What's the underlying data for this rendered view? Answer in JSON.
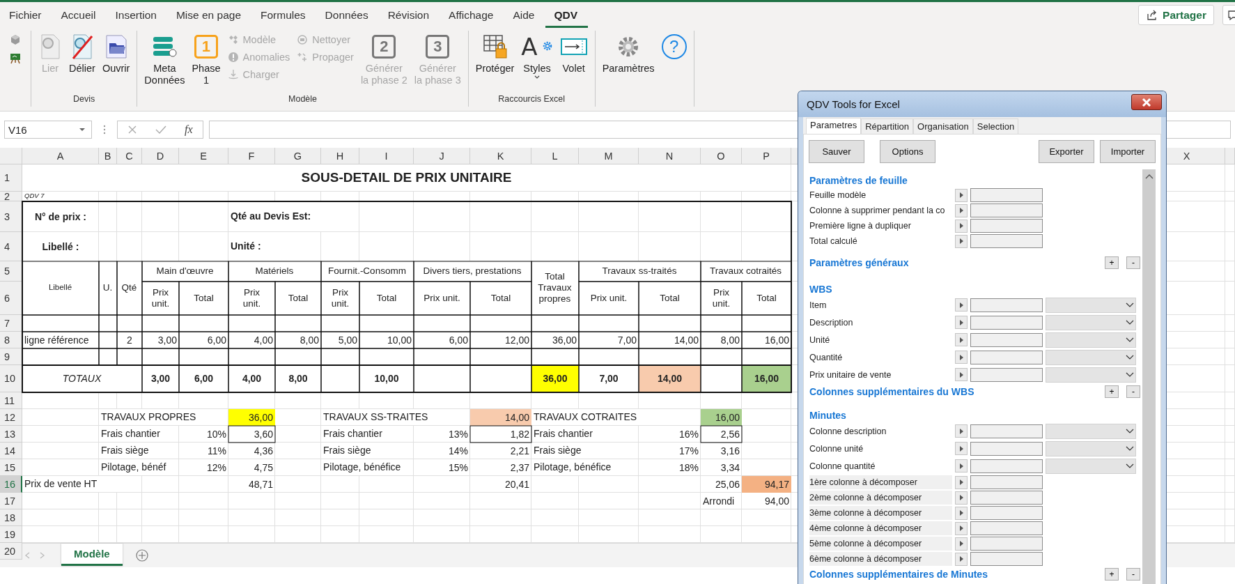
{
  "ribbon": {
    "tabs": [
      {
        "label": "Fichier",
        "selected": false
      },
      {
        "label": "Accueil",
        "selected": false
      },
      {
        "label": "Insertion",
        "selected": false
      },
      {
        "label": "Mise en page",
        "selected": false
      },
      {
        "label": "Formules",
        "selected": false
      },
      {
        "label": "Données",
        "selected": false
      },
      {
        "label": "Révision",
        "selected": false
      },
      {
        "label": "Affichage",
        "selected": false
      },
      {
        "label": "Aide",
        "selected": false
      },
      {
        "label": "QDV",
        "selected": true
      }
    ],
    "share_button": "Partager",
    "groups": [
      {
        "label": "Devis",
        "items": [
          {
            "kind": "large",
            "label": "Lier",
            "disabled": true
          },
          {
            "kind": "large",
            "label": "Délier",
            "disabled": false
          },
          {
            "kind": "large",
            "label": "Ouvrir",
            "disabled": false
          }
        ]
      },
      {
        "label": "Modèle",
        "items": [
          {
            "kind": "large",
            "label": "Meta\nDonnées",
            "disabled": false
          },
          {
            "kind": "large",
            "label": "Phase\n1",
            "badge": "1",
            "disabled": false
          },
          {
            "kind": "stack",
            "items": [
              {
                "label": "Modèle",
                "disabled": true
              },
              {
                "label": "Anomalies",
                "disabled": true
              },
              {
                "label": "Charger",
                "disabled": true
              }
            ]
          },
          {
            "kind": "stack",
            "items": [
              {
                "label": "Nettoyer",
                "disabled": true
              },
              {
                "label": "Propager",
                "disabled": true
              }
            ]
          },
          {
            "kind": "large",
            "label": "Générer\nla phase 2",
            "badge": "2",
            "disabled": true
          },
          {
            "kind": "large",
            "label": "Générer\nla phase 3",
            "badge": "3",
            "disabled": true
          }
        ]
      },
      {
        "label": "Raccourcis Excel",
        "items": [
          {
            "kind": "large",
            "label": "Protéger",
            "disabled": false
          },
          {
            "kind": "large",
            "label": "Styles",
            "badge": "A",
            "has_menu": true,
            "disabled": false
          },
          {
            "kind": "large",
            "label": "Volet",
            "disabled": false
          }
        ]
      },
      {
        "items": [
          {
            "kind": "large",
            "label": "Paramètres",
            "disabled": false
          },
          {
            "kind": "help",
            "badge": "?"
          }
        ]
      }
    ]
  },
  "formula_bar": {
    "name_box": "V16",
    "function_label": "fx"
  },
  "sheet": {
    "columns": [
      "A",
      "B",
      "C",
      "D",
      "E",
      "F",
      "G",
      "H",
      "I",
      "J",
      "K",
      "L",
      "M",
      "N",
      "O",
      "P"
    ],
    "columns_right_of_panel": [
      "X"
    ],
    "rows": [
      {
        "number": "1",
        "selected": false,
        "cells": [
          {
            "text": "SOUS-DETAIL DE PRIX UNITAIRE",
            "kind": "title"
          }
        ]
      },
      {
        "number": "2",
        "selected": false,
        "cells": [
          {
            "text": "QDV 7",
            "kind": "note"
          }
        ]
      },
      {
        "number": "3",
        "selected": false,
        "cells": [
          {
            "text": "N° de prix :",
            "kind": "strong"
          },
          {
            "text": "Qté au Devis Est:",
            "kind": "strong"
          }
        ]
      },
      {
        "number": "4",
        "selected": false,
        "cells": [
          {
            "text": "Libellé :",
            "kind": "strong"
          },
          {
            "text": "Unité :",
            "kind": "strong"
          }
        ]
      },
      {
        "number": "5",
        "selected": false,
        "cells": [
          {
            "text": "Libellé",
            "kind": "small-header"
          },
          {
            "text": "U.",
            "kind": "header"
          },
          {
            "text": "Qté",
            "kind": "header"
          },
          {
            "text": "Main d'œuvre",
            "kind": "header"
          },
          {
            "text": "Matériels",
            "kind": "header"
          },
          {
            "text": "Fournit.-Consomm",
            "kind": "header"
          },
          {
            "text": "Divers tiers, prestations",
            "kind": "header"
          },
          {
            "text": "Total Travaux propres",
            "kind": "stacked-header"
          },
          {
            "text": "Travaux ss-traités",
            "kind": "header"
          },
          {
            "text": "Travaux cotraités",
            "kind": "header"
          }
        ]
      },
      {
        "number": "6",
        "selected": false,
        "cells": [
          {
            "text": "Prix unit.",
            "kind": "stacked-header"
          },
          {
            "text": "Total",
            "kind": "header"
          },
          {
            "text": "Prix unit.",
            "kind": "stacked-header"
          },
          {
            "text": "Total",
            "kind": "header"
          },
          {
            "text": "Prix unit.",
            "kind": "stacked-header"
          },
          {
            "text": "Total",
            "kind": "header"
          },
          {
            "text": "Prix unit.",
            "kind": "header"
          },
          {
            "text": "Total",
            "kind": "header"
          },
          {
            "text": "Prix unit.",
            "kind": "header"
          },
          {
            "text": "Total",
            "kind": "header"
          },
          {
            "text": "Prix unit.",
            "kind": "stacked-header"
          },
          {
            "text": "Total",
            "kind": "header"
          }
        ]
      },
      {
        "number": "7",
        "selected": false
      },
      {
        "number": "8",
        "selected": false,
        "cells": [
          {
            "text": "ligne référence",
            "kind": "text"
          },
          {
            "text": "2",
            "kind": "number"
          },
          {
            "text": "3,00",
            "kind": "number"
          },
          {
            "text": "6,00",
            "kind": "number"
          },
          {
            "text": "4,00",
            "kind": "number"
          },
          {
            "text": "8,00",
            "kind": "number"
          },
          {
            "text": "5,00",
            "kind": "number"
          },
          {
            "text": "10,00",
            "kind": "number"
          },
          {
            "text": "6,00",
            "kind": "number"
          },
          {
            "text": "12,00",
            "kind": "number"
          },
          {
            "text": "36,00",
            "kind": "number"
          },
          {
            "text": "7,00",
            "kind": "number"
          },
          {
            "text": "14,00",
            "kind": "number"
          },
          {
            "text": "8,00",
            "kind": "number"
          },
          {
            "text": "16,00",
            "kind": "number"
          }
        ]
      },
      {
        "number": "9",
        "selected": false
      },
      {
        "number": "10",
        "selected": false,
        "cells": [
          {
            "text": "TOTAUX",
            "kind": "total-label"
          },
          {
            "text": "3,00",
            "kind": "total"
          },
          {
            "text": "6,00",
            "kind": "total"
          },
          {
            "text": "4,00",
            "kind": "total"
          },
          {
            "text": "8,00",
            "kind": "total"
          },
          {
            "text": "10,00",
            "kind": "total"
          },
          {
            "text": "36,00",
            "kind": "total",
            "color": "#ffff00"
          },
          {
            "text": "7,00",
            "kind": "total"
          },
          {
            "text": "14,00",
            "kind": "total",
            "color": "#f8cbad"
          },
          {
            "text": "16,00",
            "kind": "total",
            "color": "#a9d08e"
          }
        ]
      },
      {
        "number": "11",
        "selected": false
      },
      {
        "number": "12",
        "selected": false,
        "cells": [
          {
            "text": "TRAVAUX PROPRES",
            "kind": "text"
          },
          {
            "text": "36,00",
            "kind": "number",
            "color": "#ffff00"
          },
          {
            "text": "TRAVAUX SS-TRAITES",
            "kind": "text"
          },
          {
            "text": "14,00",
            "kind": "number",
            "color": "#f8cbad"
          },
          {
            "text": "TRAVAUX COTRAITES",
            "kind": "text"
          },
          {
            "text": "16,00",
            "kind": "number",
            "color": "#a9d08e"
          }
        ]
      },
      {
        "number": "13",
        "selected": false,
        "cells": [
          {
            "text": "Frais chantier",
            "kind": "text"
          },
          {
            "text": "10%",
            "kind": "number"
          },
          {
            "text": "3,60",
            "kind": "number"
          },
          {
            "text": "Frais chantier",
            "kind": "text"
          },
          {
            "text": "13%",
            "kind": "number"
          },
          {
            "text": "1,82",
            "kind": "number"
          },
          {
            "text": "Frais chantier",
            "kind": "text"
          },
          {
            "text": "16%",
            "kind": "number"
          },
          {
            "text": "2,56",
            "kind": "number"
          }
        ]
      },
      {
        "number": "14",
        "selected": false,
        "cells": [
          {
            "text": "Frais siège",
            "kind": "text"
          },
          {
            "text": "11%",
            "kind": "number"
          },
          {
            "text": "4,36",
            "kind": "number"
          },
          {
            "text": "Frais siège",
            "kind": "text"
          },
          {
            "text": "14%",
            "kind": "number"
          },
          {
            "text": "2,21",
            "kind": "number"
          },
          {
            "text": "Frais siège",
            "kind": "text"
          },
          {
            "text": "17%",
            "kind": "number"
          },
          {
            "text": "3,16",
            "kind": "number"
          }
        ]
      },
      {
        "number": "15",
        "selected": false,
        "cells": [
          {
            "text": "Pilotage, bénéf",
            "kind": "text"
          },
          {
            "text": "12%",
            "kind": "number"
          },
          {
            "text": "4,75",
            "kind": "number"
          },
          {
            "text": "Pilotage, bénéfice",
            "kind": "text"
          },
          {
            "text": "15%",
            "kind": "number"
          },
          {
            "text": "2,37",
            "kind": "number"
          },
          {
            "text": "Pilotage, bénéfice",
            "kind": "text"
          },
          {
            "text": "18%",
            "kind": "number"
          },
          {
            "text": "3,34",
            "kind": "number"
          }
        ]
      },
      {
        "number": "16",
        "selected": true,
        "cells": [
          {
            "text": "Prix de vente HT",
            "kind": "text"
          },
          {
            "text": "48,71",
            "kind": "number"
          },
          {
            "text": "20,41",
            "kind": "number"
          },
          {
            "text": "25,06",
            "kind": "number"
          },
          {
            "text": "94,17",
            "kind": "number",
            "color": "#f4b183"
          }
        ]
      },
      {
        "number": "17",
        "selected": false,
        "cells": [
          {
            "text": "Arrondi",
            "kind": "text"
          },
          {
            "text": "94,00",
            "kind": "number"
          }
        ]
      },
      {
        "number": "18",
        "selected": false
      },
      {
        "number": "19",
        "selected": false
      },
      {
        "number": "20",
        "selected": false
      }
    ]
  },
  "sheet_tabs": [
    {
      "label": "Modèle",
      "selected": true
    }
  ],
  "panel": {
    "title": "QDV Tools for Excel",
    "tabs": [
      {
        "label": "Parametres",
        "selected": true
      },
      {
        "label": "Répartition",
        "selected": false
      },
      {
        "label": "Organisation",
        "selected": false
      },
      {
        "label": "Selection",
        "selected": false
      }
    ],
    "buttons": [
      "Sauver",
      "Options",
      "Exporter",
      "Importer"
    ],
    "sections": [
      {
        "title": "Paramètres de feuille",
        "rows": [
          {
            "label": "Feuille modèle",
            "kind": "field"
          },
          {
            "label": "Colonne à supprimer pendant la co",
            "kind": "field"
          },
          {
            "label": "Première ligne à dupliquer",
            "kind": "field"
          },
          {
            "label": "Total calculé",
            "kind": "field"
          }
        ]
      },
      {
        "title": "Paramètres généraux",
        "buttons": [
          "+",
          "-"
        ]
      },
      {
        "title": "WBS",
        "rows": [
          {
            "label": "Item",
            "kind": "combo"
          },
          {
            "label": "Description",
            "kind": "combo"
          },
          {
            "label": "Unité",
            "kind": "combo"
          },
          {
            "label": "Quantité",
            "kind": "combo"
          },
          {
            "label": "Prix unitaire de vente",
            "kind": "combo"
          }
        ]
      },
      {
        "title": "Colonnes supplémentaires du WBS",
        "buttons": [
          "+",
          "-"
        ]
      },
      {
        "title": "Minutes",
        "rows": [
          {
            "label": "Colonne description",
            "kind": "combo"
          },
          {
            "label": "Colonne unité",
            "kind": "combo"
          },
          {
            "label": "Colonne quantité",
            "kind": "combo"
          },
          {
            "label": "1ère colonne à décomposer",
            "kind": "shaded"
          },
          {
            "label": "2ème colonne à décomposer",
            "kind": "shaded"
          },
          {
            "label": "3ème colonne à décomposer",
            "kind": "shaded"
          },
          {
            "label": "4ème colonne à décomposer",
            "kind": "shaded"
          },
          {
            "label": "5ème colonne à décomposer",
            "kind": "shaded"
          },
          {
            "label": "6ème colonne à décomposer",
            "kind": "shaded"
          }
        ]
      },
      {
        "title": "Colonnes supplémentaires de Minutes",
        "buttons": [
          "+",
          "-"
        ]
      }
    ]
  }
}
